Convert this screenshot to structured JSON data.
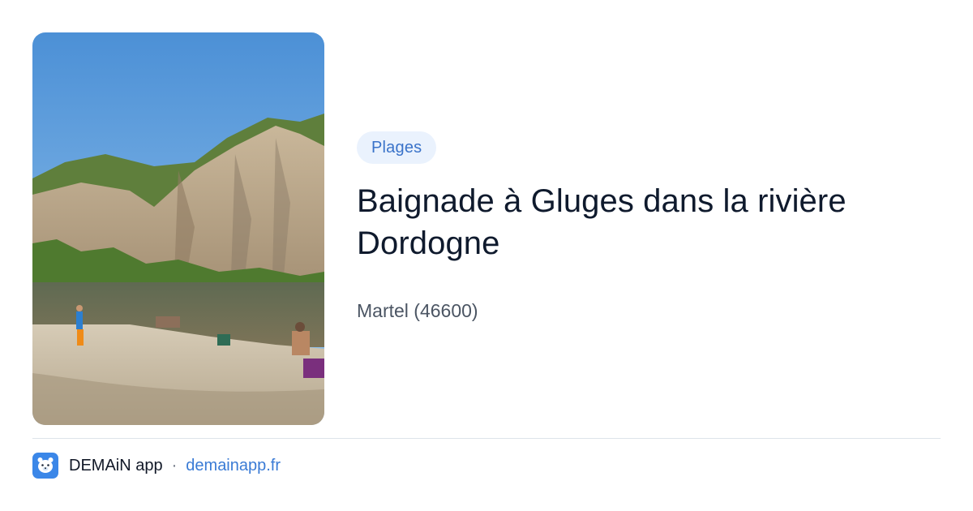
{
  "card": {
    "image": {
      "alt": "",
      "scene-icon": "photo-icon"
    },
    "category": "Plages",
    "title": "Baignade à Gluges dans la rivière Dordogne",
    "location": "Martel (46600)"
  },
  "footer": {
    "app_icon": "bear-face-icon",
    "app_name": "DEMAiN app",
    "separator": "·",
    "site": "demainapp.fr"
  },
  "colors": {
    "badge_bg": "#eaf2fd",
    "badge_text": "#3a73c9",
    "title_text": "#0f1a2d",
    "link": "#3a7bd5",
    "app_icon_bg": "#3b87e8"
  }
}
